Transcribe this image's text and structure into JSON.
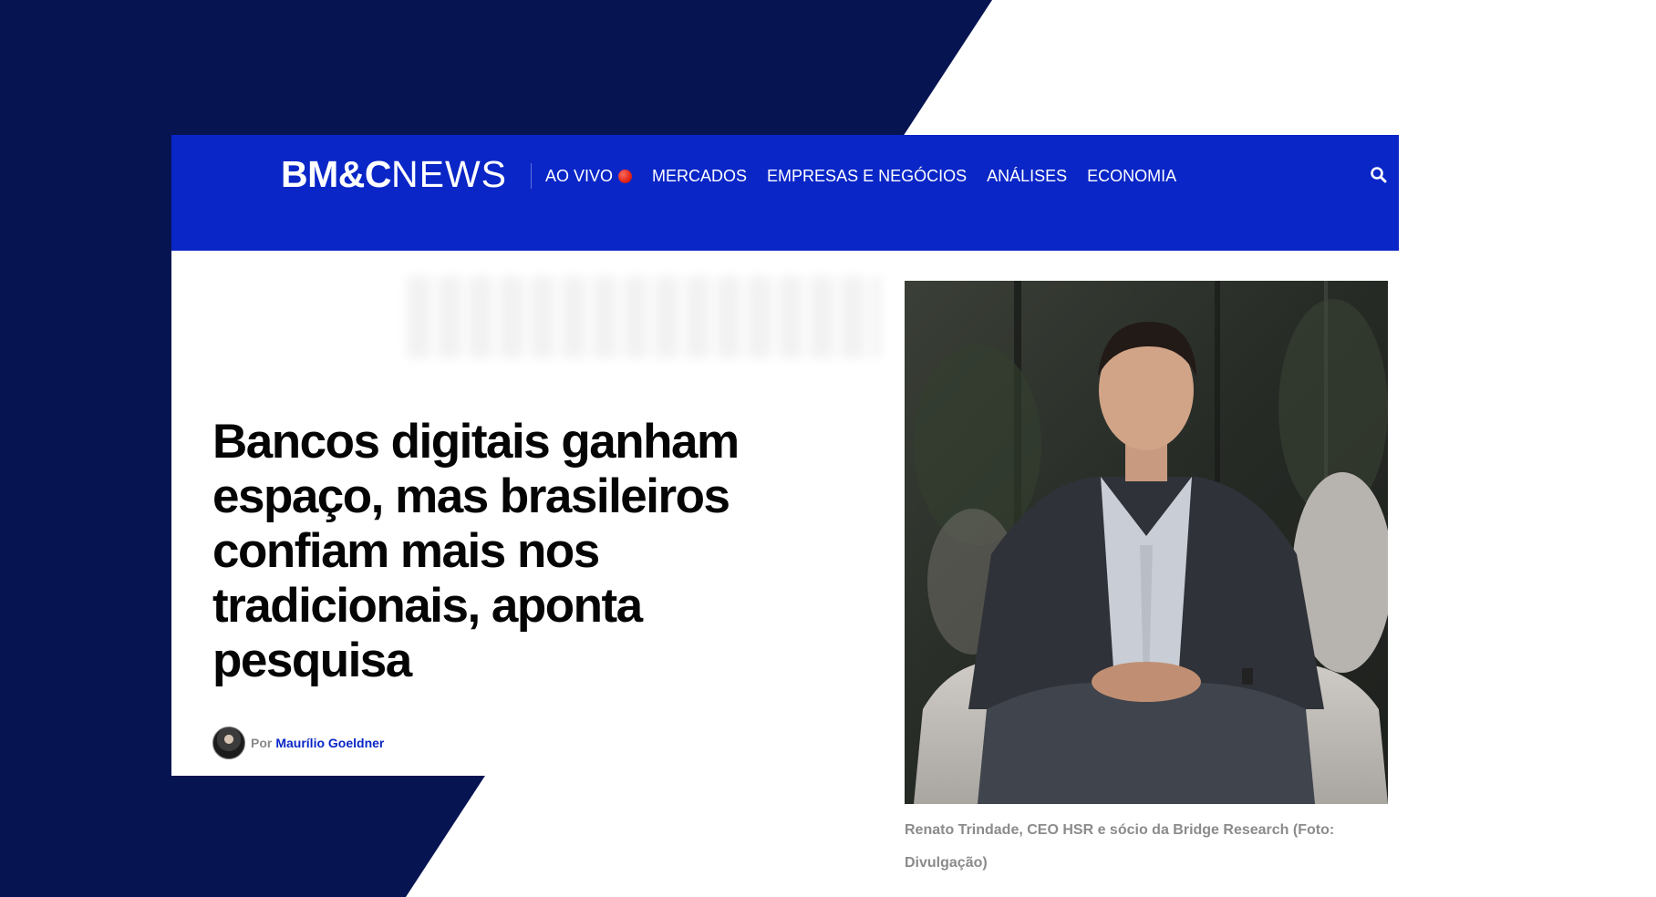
{
  "colors": {
    "navy_background": "#061452",
    "nav_blue": "#0a26c7",
    "author_link": "#0a26c7",
    "live_indicator": "#e0251a"
  },
  "header": {
    "logo_bold": "BM&C",
    "logo_light": "NEWS",
    "nav_items": [
      {
        "label": "AO VIVO",
        "live": true
      },
      {
        "label": "MERCADOS"
      },
      {
        "label": "EMPRESAS E NEGÓCIOS"
      },
      {
        "label": "ANÁLISES"
      },
      {
        "label": "ECONOMIA"
      }
    ],
    "search_icon": "search-icon"
  },
  "article": {
    "headline": "Bancos digitais ganham espaço, mas brasileiros confiam mais nos tradicionais, aponta pesquisa",
    "byline_prefix": "Por",
    "author": "Maurílio Goeldner",
    "photo_caption": "Renato Trindade, CEO HSR e sócio da Bridge Research (Foto: Divulgação)"
  }
}
